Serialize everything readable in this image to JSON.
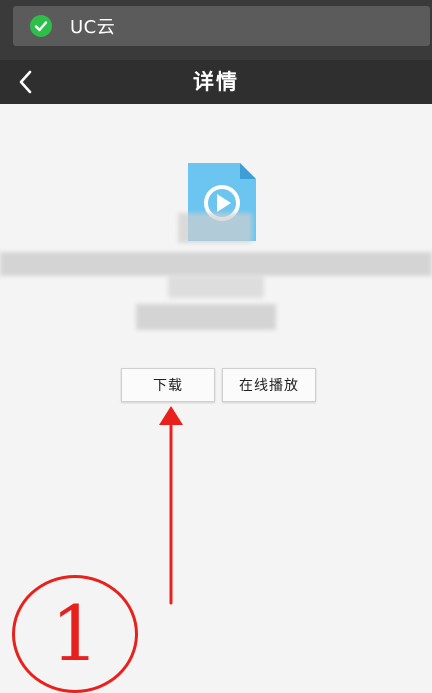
{
  "notification": {
    "text": "UC云",
    "icon": "check-circle-icon",
    "icon_color": "#2dbf4a"
  },
  "header": {
    "title": "详情",
    "back_icon": "chevron-left-icon"
  },
  "file": {
    "icon": "video-file-icon",
    "color": "#6bc5f0"
  },
  "actions": {
    "download": "下载",
    "play_online": "在线播放"
  },
  "annotation": {
    "number": "1",
    "color": "#e8211d"
  }
}
